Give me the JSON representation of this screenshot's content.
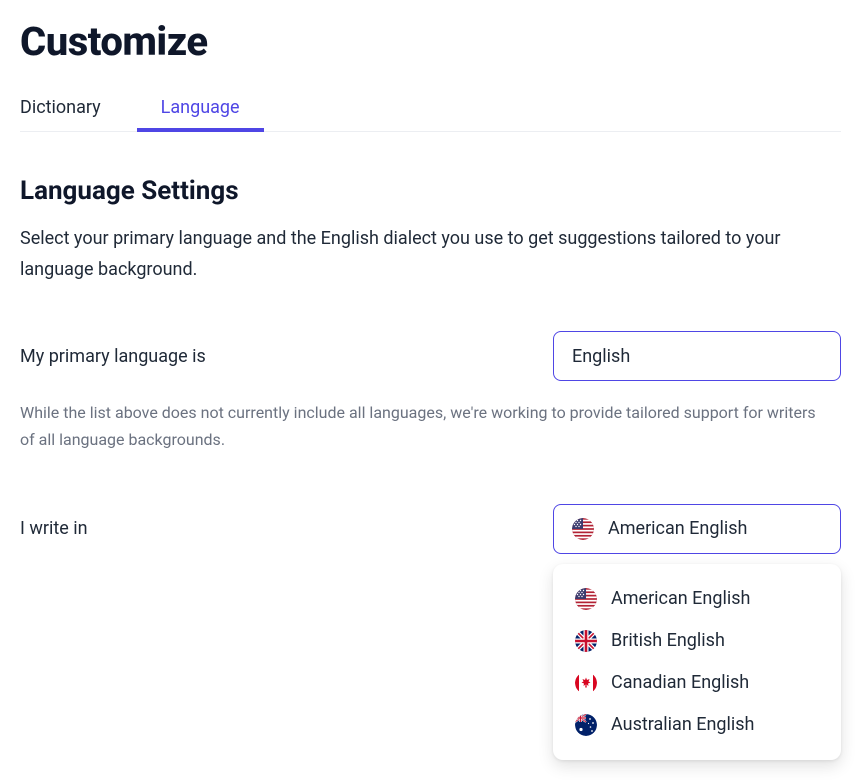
{
  "header": {
    "title": "Customize"
  },
  "tabs": [
    {
      "label": "Dictionary",
      "active": false
    },
    {
      "label": "Language",
      "active": true
    }
  ],
  "section": {
    "title": "Language Settings",
    "description": "Select your primary language and the English dialect you use to get suggestions tailored to your language background."
  },
  "primary_language": {
    "label": "My primary language is",
    "selected": "English",
    "hint": "While the list above does not currently include all languages, we're working to provide tailored support for writers of all language backgrounds."
  },
  "dialect": {
    "label": "I write in",
    "selected": "American English",
    "selected_flag": "us",
    "dropdown_open": true,
    "options": [
      {
        "label": "American English",
        "flag": "us"
      },
      {
        "label": "British English",
        "flag": "gb"
      },
      {
        "label": "Canadian English",
        "flag": "ca"
      },
      {
        "label": "Australian English",
        "flag": "au"
      }
    ]
  }
}
